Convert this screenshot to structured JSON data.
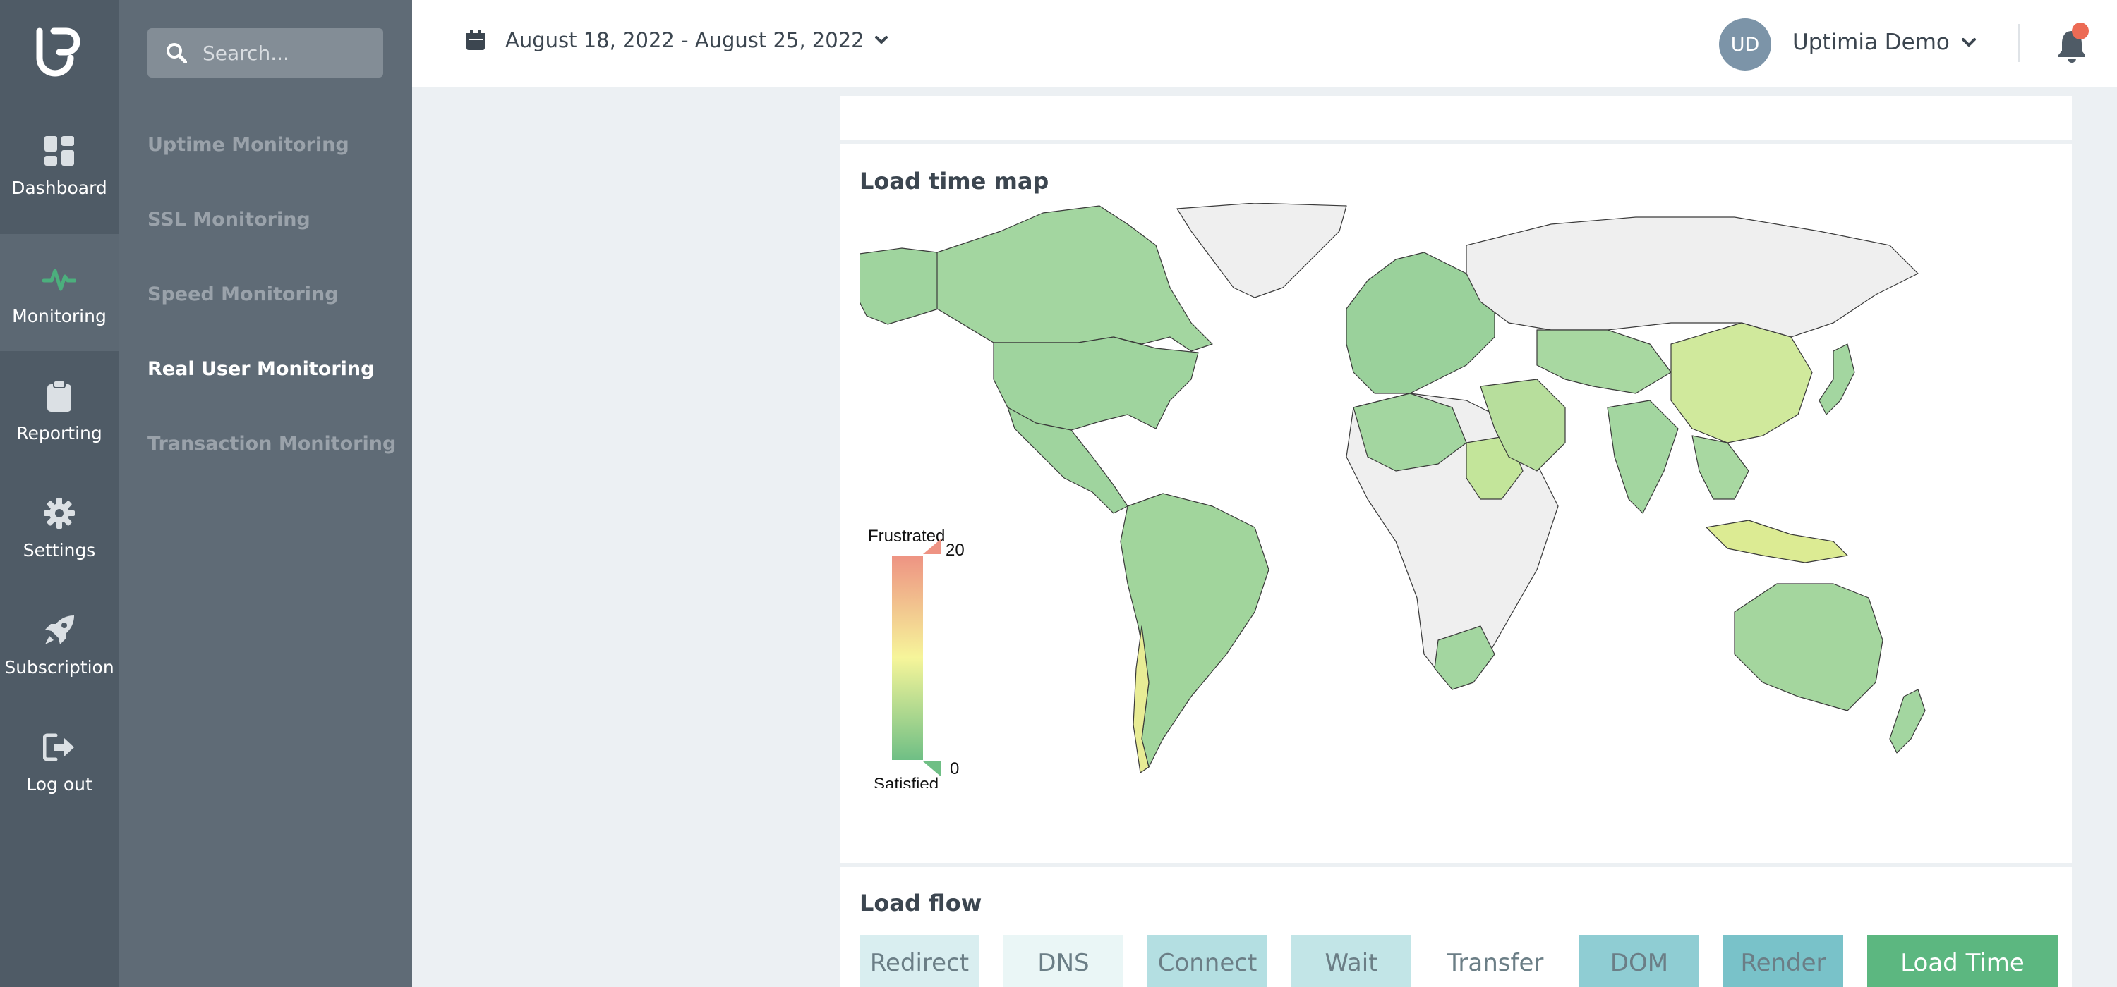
{
  "sidebar": {
    "items": [
      {
        "label": "Dashboard",
        "icon": "dashboard-icon"
      },
      {
        "label": "Monitoring",
        "icon": "pulse-icon",
        "active": true
      },
      {
        "label": "Reporting",
        "icon": "clipboard-icon"
      },
      {
        "label": "Settings",
        "icon": "gear-icon"
      },
      {
        "label": "Subscription",
        "icon": "rocket-icon"
      },
      {
        "label": "Log out",
        "icon": "logout-icon"
      }
    ]
  },
  "subnav": {
    "search_placeholder": "Search...",
    "items": [
      {
        "label": "Uptime Monitoring"
      },
      {
        "label": "SSL Monitoring"
      },
      {
        "label": "Speed Monitoring"
      },
      {
        "label": "Real User Monitoring",
        "active": true
      },
      {
        "label": "Transaction Monitoring"
      }
    ]
  },
  "header": {
    "date_range": "August 18, 2022 - August 25, 2022",
    "avatar_initials": "UD",
    "user_name": "Uptimia Demo"
  },
  "map": {
    "title": "Load time map",
    "legend": {
      "top_label": "Frustrated",
      "bottom_label": "Satisfied",
      "max": "20",
      "min": "0"
    }
  },
  "flow": {
    "title": "Load flow",
    "segments": [
      {
        "label": "Redirect",
        "color": "#d9eef0"
      },
      {
        "label": "DNS",
        "color": "#eaf6f6"
      },
      {
        "label": "Connect",
        "color": "#b4dfe2"
      },
      {
        "label": "Wait",
        "color": "#c2e5e7"
      },
      {
        "label": "Transfer",
        "color": "#ffffff"
      },
      {
        "label": "DOM",
        "color": "#8fcdd3"
      },
      {
        "label": "Render",
        "color": "#79c2c9"
      },
      {
        "label": "Load Time",
        "color": "#5cb780"
      }
    ]
  },
  "colors": {
    "accent_green": "#4caf7d",
    "notification": "#ec6b55"
  }
}
